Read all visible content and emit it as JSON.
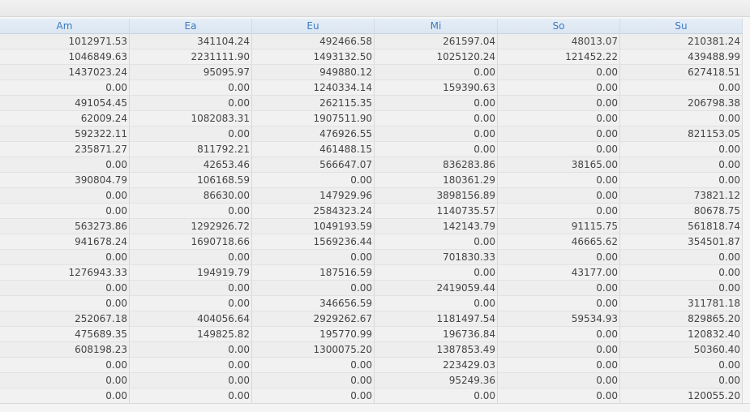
{
  "table": {
    "columns": [
      "Am",
      "Ea",
      "Eu",
      "Mi",
      "So",
      "Su"
    ],
    "rows": [
      [
        "1012971.53",
        "341104.24",
        "492466.58",
        "261597.04",
        "48013.07",
        "210381.24"
      ],
      [
        "1046849.63",
        "2231111.90",
        "1493132.50",
        "1025120.24",
        "121452.22",
        "439488.99"
      ],
      [
        "1437023.24",
        "95095.97",
        "949880.12",
        "0.00",
        "0.00",
        "627418.51"
      ],
      [
        "0.00",
        "0.00",
        "1240334.14",
        "159390.63",
        "0.00",
        "0.00"
      ],
      [
        "491054.45",
        "0.00",
        "262115.35",
        "0.00",
        "0.00",
        "206798.38"
      ],
      [
        "62009.24",
        "1082083.31",
        "1907511.90",
        "0.00",
        "0.00",
        "0.00"
      ],
      [
        "592322.11",
        "0.00",
        "476926.55",
        "0.00",
        "0.00",
        "821153.05"
      ],
      [
        "235871.27",
        "811792.21",
        "461488.15",
        "0.00",
        "0.00",
        "0.00"
      ],
      [
        "0.00",
        "42653.46",
        "566647.07",
        "836283.86",
        "38165.00",
        "0.00"
      ],
      [
        "390804.79",
        "106168.59",
        "0.00",
        "180361.29",
        "0.00",
        "0.00"
      ],
      [
        "0.00",
        "86630.00",
        "147929.96",
        "3898156.89",
        "0.00",
        "73821.12"
      ],
      [
        "0.00",
        "0.00",
        "2584323.24",
        "1140735.57",
        "0.00",
        "80678.75"
      ],
      [
        "563273.86",
        "1292926.72",
        "1049193.59",
        "142143.79",
        "91115.75",
        "561818.74"
      ],
      [
        "941678.24",
        "1690718.66",
        "1569236.44",
        "0.00",
        "46665.62",
        "354501.87"
      ],
      [
        "0.00",
        "0.00",
        "0.00",
        "701830.33",
        "0.00",
        "0.00"
      ],
      [
        "1276943.33",
        "194919.79",
        "187516.59",
        "0.00",
        "43177.00",
        "0.00"
      ],
      [
        "0.00",
        "0.00",
        "0.00",
        "2419059.44",
        "0.00",
        "0.00"
      ],
      [
        "0.00",
        "0.00",
        "346656.59",
        "0.00",
        "0.00",
        "311781.18"
      ],
      [
        "252067.18",
        "404056.64",
        "2929262.67",
        "1181497.54",
        "59534.93",
        "829865.20"
      ],
      [
        "475689.35",
        "149825.82",
        "195770.99",
        "196736.84",
        "0.00",
        "120832.40"
      ],
      [
        "608198.23",
        "0.00",
        "1300075.20",
        "1387853.49",
        "0.00",
        "50360.40"
      ],
      [
        "0.00",
        "0.00",
        "0.00",
        "223429.03",
        "0.00",
        "0.00"
      ],
      [
        "0.00",
        "0.00",
        "0.00",
        "95249.36",
        "0.00",
        "0.00"
      ],
      [
        "0.00",
        "0.00",
        "0.00",
        "0.00",
        "0.00",
        "120055.20"
      ]
    ]
  },
  "colors": {
    "header_text": "#3b7bc4",
    "header_bg": "#dfe9f4",
    "cell_text": "#444444"
  }
}
